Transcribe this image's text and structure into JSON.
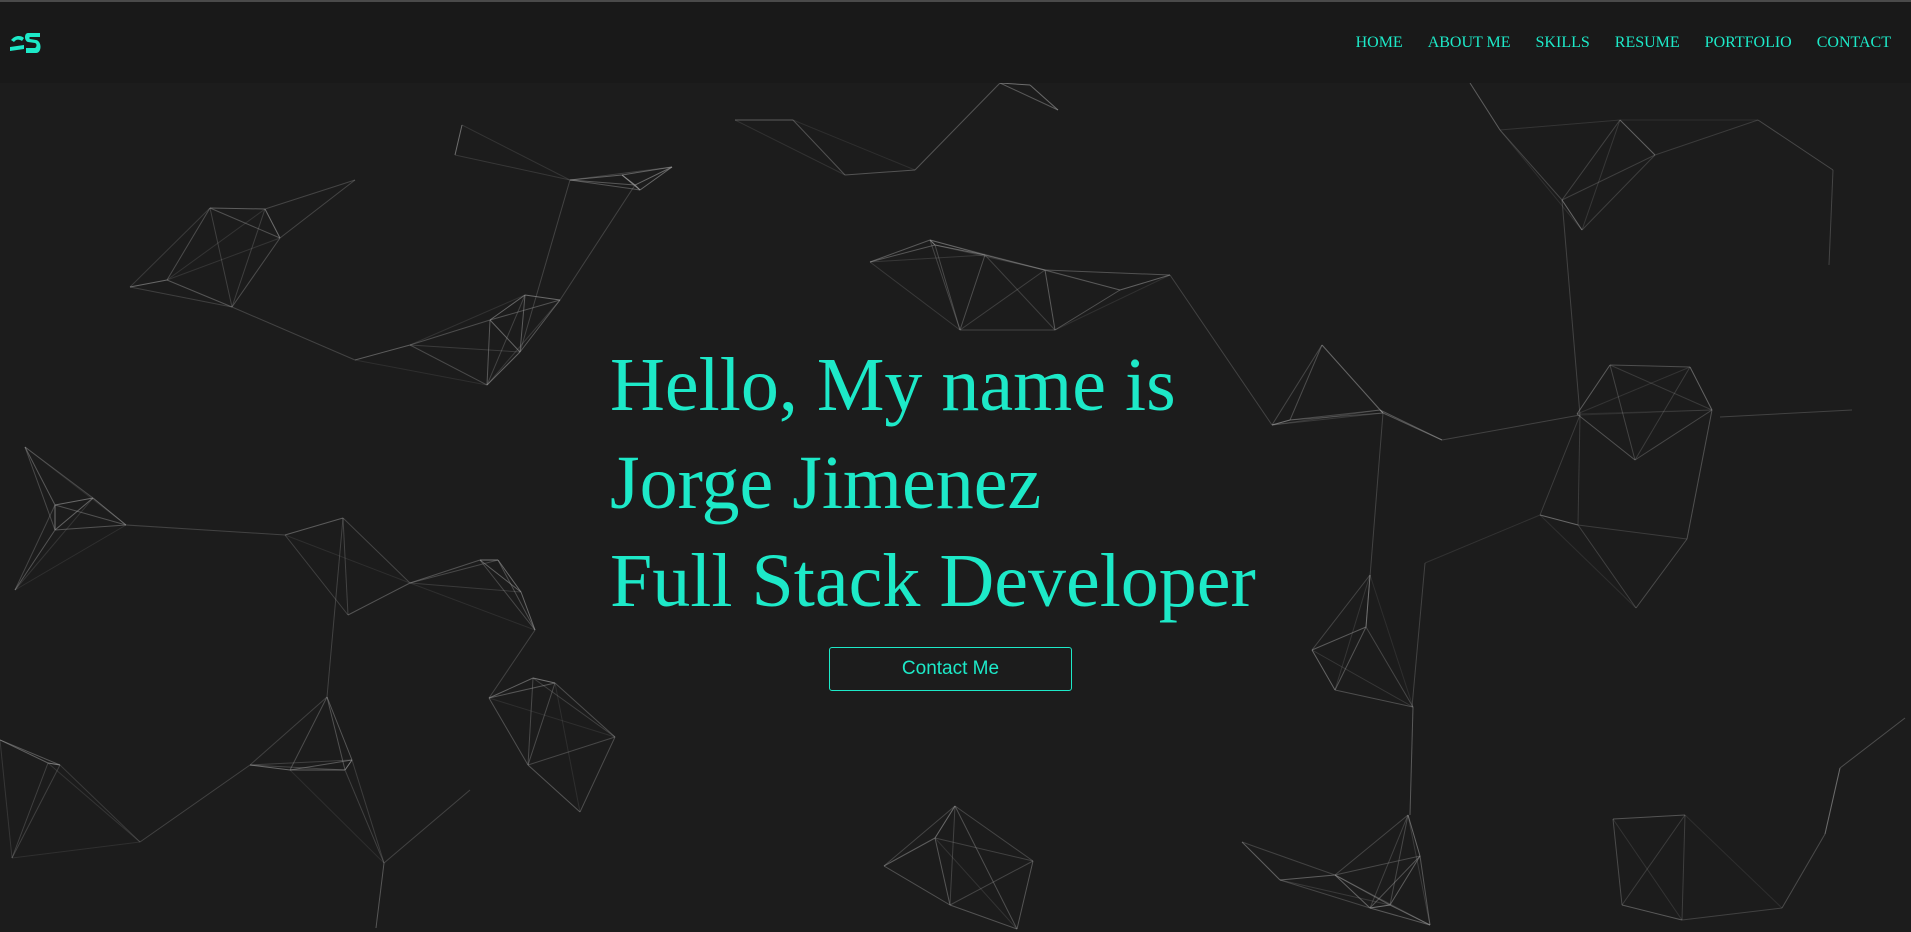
{
  "theme": {
    "background": "#1c1c1c",
    "navbar_background": "#191919",
    "accent": "#1de9c8",
    "network_line": "#9a9a9a"
  },
  "header": {
    "logo_icon": "js-monogram-logo-icon",
    "nav": [
      {
        "label": "HOME"
      },
      {
        "label": "ABOUT ME"
      },
      {
        "label": "SKILLS"
      },
      {
        "label": "RESUME"
      },
      {
        "label": "PORTFOLIO"
      },
      {
        "label": "CONTACT"
      }
    ]
  },
  "hero": {
    "greeting": "Hello, My name is",
    "name": "Jorge Jimenez",
    "role": "Full Stack Developer",
    "cta_label": "Contact Me"
  }
}
